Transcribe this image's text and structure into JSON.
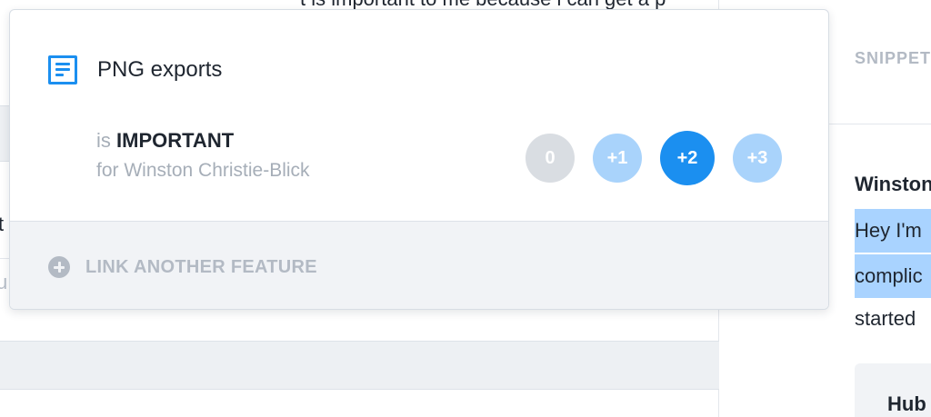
{
  "background": {
    "top_text": "t is important to me because i can get a p",
    "fragment_t": "t",
    "fragment_u": "u"
  },
  "snippet_panel": {
    "label": "SNIPPET",
    "author": "Winston",
    "lines": [
      "Hey I'm",
      "complic",
      "started"
    ],
    "card_title": "Hub"
  },
  "popover": {
    "feature": {
      "icon": "document-icon",
      "title": "PNG exports"
    },
    "importance": {
      "prefix": "is",
      "level": "IMPORTANT",
      "for_text": "for Winston Christie-Blick"
    },
    "scores": [
      {
        "label": "0",
        "selected": false
      },
      {
        "label": "+1",
        "selected": false
      },
      {
        "label": "+2",
        "selected": true
      },
      {
        "label": "+3",
        "selected": false
      }
    ],
    "footer": {
      "icon": "plus-circle-icon",
      "link_label": "LINK ANOTHER FEATURE"
    }
  },
  "colors": {
    "accent": "#1b8ff0",
    "accent_light": "#a9d3fb",
    "neutral_score": "#d9dde2",
    "highlight": "#a9d3ff"
  }
}
